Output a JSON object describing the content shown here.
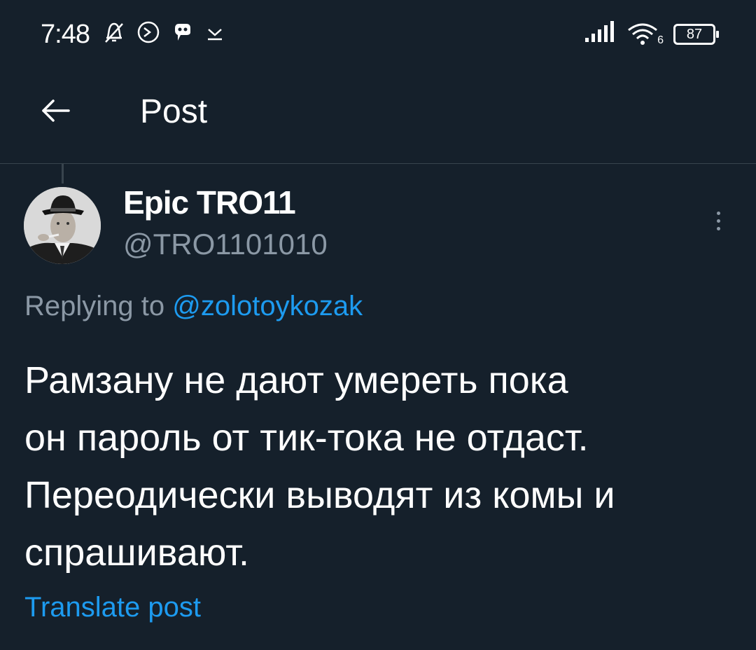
{
  "status_bar": {
    "time": "7:48",
    "battery_level": "87",
    "wifi_generation": "6",
    "icons_left": [
      "alarm-off-icon",
      "data-saver-icon",
      "app-notification-icon",
      "download-icon"
    ],
    "icons_right": [
      "signal-icon",
      "wifi-icon",
      "battery-icon"
    ]
  },
  "header": {
    "title": "Post",
    "back_icon": "arrow-left-icon"
  },
  "post": {
    "author_name": "Epic TRO11",
    "author_handle": "@TRO1101010",
    "reply_prefix": "Replying to",
    "reply_to": "@zolotoykozak",
    "text_lines": [
      "Рамзану не дают умереть пока",
      "он пароль от тик-тока не отдаст.",
      "Переодически выводят из комы и",
      "спрашивают."
    ],
    "translate_label": "Translate post",
    "more_icon": "more-vertical-icon"
  },
  "colors": {
    "background": "#15202b",
    "text_primary": "#ffffff",
    "text_secondary": "#8b98a5",
    "accent": "#1d9bf0",
    "divider": "#38444d"
  }
}
